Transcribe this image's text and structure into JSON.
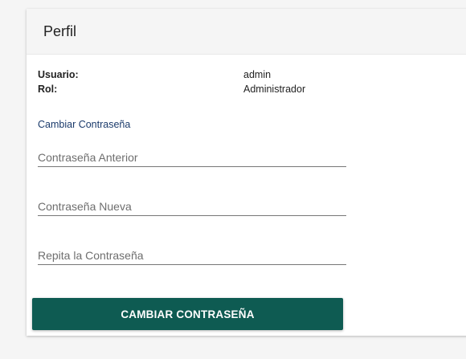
{
  "header": {
    "title": "Perfil"
  },
  "user_info": {
    "rows": [
      {
        "label": "Usuario:",
        "value": "admin"
      },
      {
        "label": "Rol:",
        "value": "Administrador"
      }
    ]
  },
  "password_form": {
    "section_title": "Cambiar Contraseña",
    "fields": [
      {
        "placeholder": "Contraseña Anterior",
        "value": ""
      },
      {
        "placeholder": "Contraseña Nueva",
        "value": ""
      },
      {
        "placeholder": "Repita la Contraseña",
        "value": ""
      }
    ],
    "submit_label": "CAMBIAR CONTRASEÑA"
  },
  "colors": {
    "accent": "#0e5b52",
    "section_title": "#1a3a6b",
    "header_bg": "#f5f5f5"
  }
}
